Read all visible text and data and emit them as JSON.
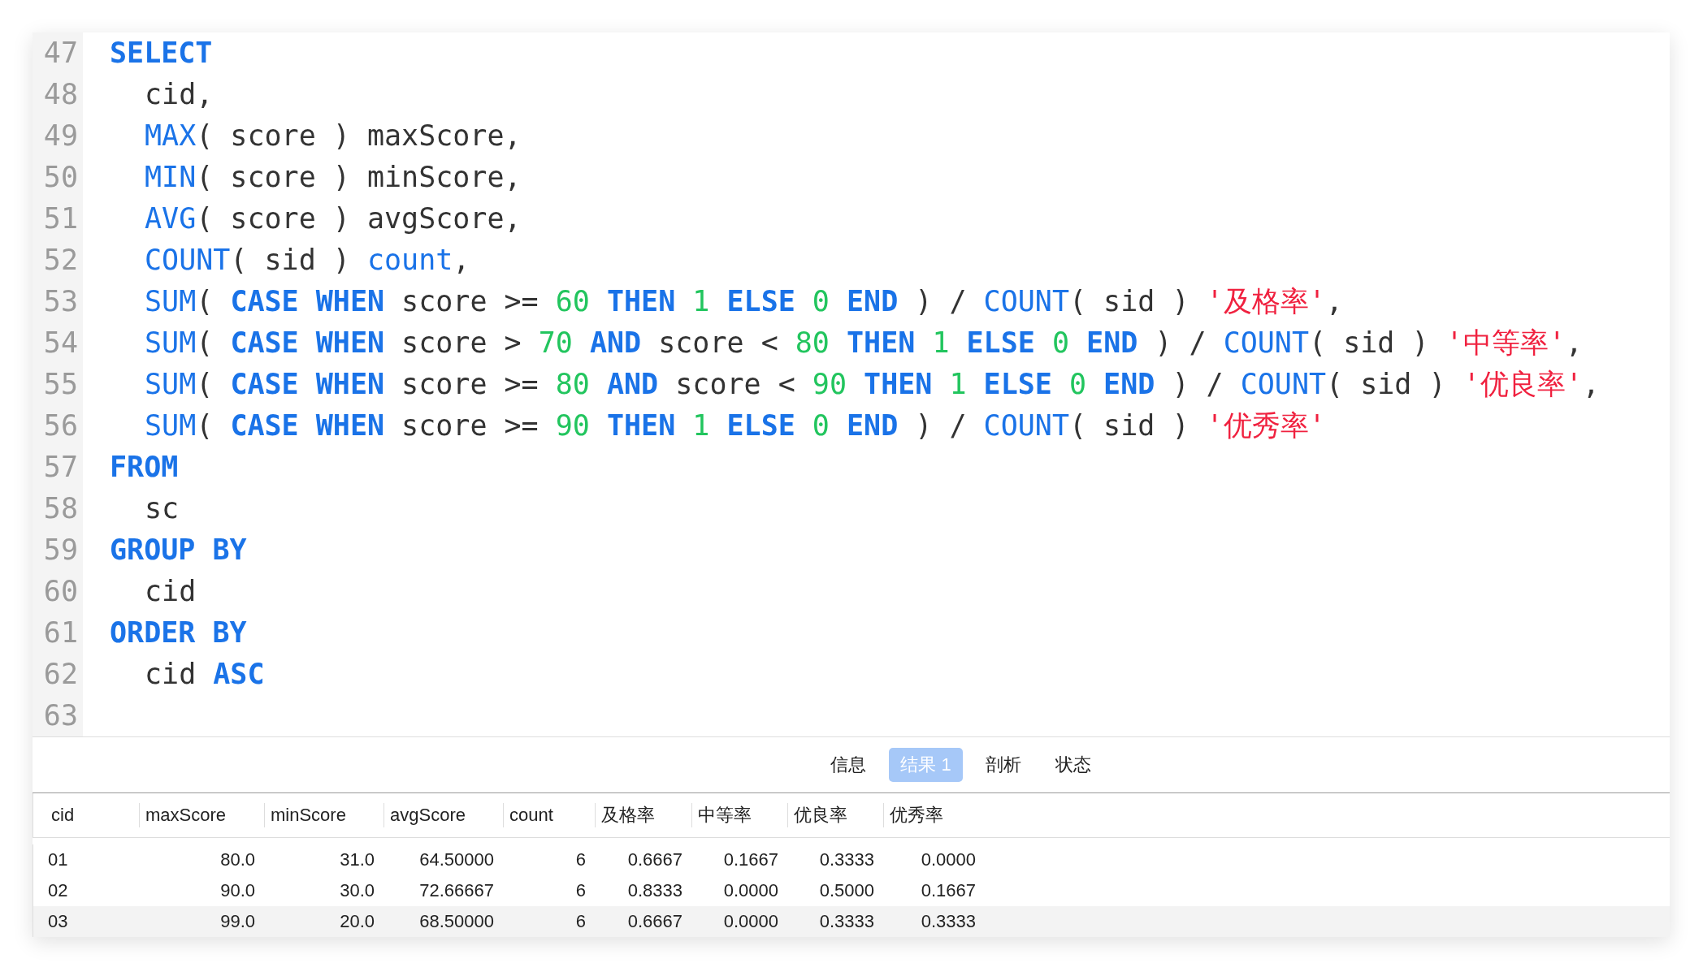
{
  "editor": {
    "lines": [
      {
        "number": "47",
        "indented": false,
        "tokens": [
          {
            "kind": "keyword",
            "text": "SELECT"
          }
        ]
      },
      {
        "number": "48",
        "indented": true,
        "tokens": [
          {
            "kind": "plain",
            "text": "cid,"
          }
        ]
      },
      {
        "number": "49",
        "indented": true,
        "tokens": [
          {
            "kind": "function",
            "text": "MAX"
          },
          {
            "kind": "plain",
            "text": "( score ) maxScore,"
          }
        ]
      },
      {
        "number": "50",
        "indented": true,
        "tokens": [
          {
            "kind": "function",
            "text": "MIN"
          },
          {
            "kind": "plain",
            "text": "( score ) minScore,"
          }
        ]
      },
      {
        "number": "51",
        "indented": true,
        "tokens": [
          {
            "kind": "function",
            "text": "AVG"
          },
          {
            "kind": "plain",
            "text": "( score ) avgScore,"
          }
        ]
      },
      {
        "number": "52",
        "indented": true,
        "tokens": [
          {
            "kind": "function",
            "text": "COUNT"
          },
          {
            "kind": "plain",
            "text": "( sid ) "
          },
          {
            "kind": "function",
            "text": "count"
          },
          {
            "kind": "plain",
            "text": ","
          }
        ]
      },
      {
        "number": "53",
        "indented": true,
        "tokens": [
          {
            "kind": "function",
            "text": "SUM"
          },
          {
            "kind": "plain",
            "text": "( "
          },
          {
            "kind": "keyword",
            "text": "CASE WHEN"
          },
          {
            "kind": "plain",
            "text": " score >= "
          },
          {
            "kind": "number",
            "text": "60"
          },
          {
            "kind": "keyword",
            "text": " THEN"
          },
          {
            "kind": "number",
            "text": " 1"
          },
          {
            "kind": "keyword",
            "text": " ELSE"
          },
          {
            "kind": "number",
            "text": " 0"
          },
          {
            "kind": "keyword",
            "text": " END"
          },
          {
            "kind": "plain",
            "text": " ) / "
          },
          {
            "kind": "function",
            "text": "COUNT"
          },
          {
            "kind": "plain",
            "text": "( sid ) "
          },
          {
            "kind": "string",
            "text": "'及格率'"
          },
          {
            "kind": "plain",
            "text": ","
          }
        ]
      },
      {
        "number": "54",
        "indented": true,
        "tokens": [
          {
            "kind": "function",
            "text": "SUM"
          },
          {
            "kind": "plain",
            "text": "( "
          },
          {
            "kind": "keyword",
            "text": "CASE WHEN"
          },
          {
            "kind": "plain",
            "text": " score > "
          },
          {
            "kind": "number",
            "text": "70"
          },
          {
            "kind": "keyword",
            "text": " AND"
          },
          {
            "kind": "plain",
            "text": " score < "
          },
          {
            "kind": "number",
            "text": "80"
          },
          {
            "kind": "keyword",
            "text": " THEN"
          },
          {
            "kind": "number",
            "text": " 1"
          },
          {
            "kind": "keyword",
            "text": " ELSE"
          },
          {
            "kind": "number",
            "text": " 0"
          },
          {
            "kind": "keyword",
            "text": " END"
          },
          {
            "kind": "plain",
            "text": " ) / "
          },
          {
            "kind": "function",
            "text": "COUNT"
          },
          {
            "kind": "plain",
            "text": "( sid ) "
          },
          {
            "kind": "string",
            "text": "'中等率'"
          },
          {
            "kind": "plain",
            "text": ","
          }
        ]
      },
      {
        "number": "55",
        "indented": true,
        "tokens": [
          {
            "kind": "function",
            "text": "SUM"
          },
          {
            "kind": "plain",
            "text": "( "
          },
          {
            "kind": "keyword",
            "text": "CASE WHEN"
          },
          {
            "kind": "plain",
            "text": " score >= "
          },
          {
            "kind": "number",
            "text": "80"
          },
          {
            "kind": "keyword",
            "text": " AND"
          },
          {
            "kind": "plain",
            "text": " score < "
          },
          {
            "kind": "number",
            "text": "90"
          },
          {
            "kind": "keyword",
            "text": " THEN"
          },
          {
            "kind": "number",
            "text": " 1"
          },
          {
            "kind": "keyword",
            "text": " ELSE"
          },
          {
            "kind": "number",
            "text": " 0"
          },
          {
            "kind": "keyword",
            "text": " END"
          },
          {
            "kind": "plain",
            "text": " ) / "
          },
          {
            "kind": "function",
            "text": "COUNT"
          },
          {
            "kind": "plain",
            "text": "( sid ) "
          },
          {
            "kind": "string",
            "text": "'优良率'"
          },
          {
            "kind": "plain",
            "text": ","
          }
        ]
      },
      {
        "number": "56",
        "indented": true,
        "tokens": [
          {
            "kind": "function",
            "text": "SUM"
          },
          {
            "kind": "plain",
            "text": "( "
          },
          {
            "kind": "keyword",
            "text": "CASE WHEN"
          },
          {
            "kind": "plain",
            "text": " score >= "
          },
          {
            "kind": "number",
            "text": "90"
          },
          {
            "kind": "keyword",
            "text": " THEN"
          },
          {
            "kind": "number",
            "text": " 1"
          },
          {
            "kind": "keyword",
            "text": " ELSE"
          },
          {
            "kind": "number",
            "text": " 0"
          },
          {
            "kind": "keyword",
            "text": " END"
          },
          {
            "kind": "plain",
            "text": " ) / "
          },
          {
            "kind": "function",
            "text": "COUNT"
          },
          {
            "kind": "plain",
            "text": "( sid ) "
          },
          {
            "kind": "string",
            "text": "'优秀率'"
          }
        ]
      },
      {
        "number": "57",
        "indented": false,
        "tokens": [
          {
            "kind": "keyword",
            "text": "FROM"
          }
        ]
      },
      {
        "number": "58",
        "indented": true,
        "tokens": [
          {
            "kind": "plain",
            "text": "sc"
          }
        ]
      },
      {
        "number": "59",
        "indented": false,
        "tokens": [
          {
            "kind": "keyword",
            "text": "GROUP BY"
          }
        ]
      },
      {
        "number": "60",
        "indented": true,
        "tokens": [
          {
            "kind": "plain",
            "text": "cid"
          }
        ]
      },
      {
        "number": "61",
        "indented": false,
        "tokens": [
          {
            "kind": "keyword",
            "text": "ORDER BY"
          }
        ]
      },
      {
        "number": "62",
        "indented": true,
        "tokens": [
          {
            "kind": "plain",
            "text": "cid "
          },
          {
            "kind": "keyword",
            "text": "ASC"
          }
        ]
      },
      {
        "number": "63"
      }
    ]
  },
  "result_tabs": [
    {
      "label": "信息",
      "selected": false
    },
    {
      "label": "结果 1",
      "selected": true
    },
    {
      "label": "剖析",
      "selected": false
    },
    {
      "label": "状态",
      "selected": false
    }
  ],
  "table": {
    "columns": [
      "cid",
      "maxScore",
      "minScore",
      "avgScore",
      "count",
      "及格率",
      "中等率",
      "优良率",
      "优秀率"
    ],
    "rows": [
      {
        "selected": false,
        "cells": [
          "01",
          "80.0",
          "31.0",
          "64.50000",
          "6",
          "0.6667",
          "0.1667",
          "0.3333",
          "0.0000"
        ]
      },
      {
        "selected": false,
        "cells": [
          "02",
          "90.0",
          "30.0",
          "72.66667",
          "6",
          "0.8333",
          "0.0000",
          "0.5000",
          "0.1667"
        ]
      },
      {
        "selected": true,
        "cells": [
          "03",
          "99.0",
          "20.0",
          "68.50000",
          "6",
          "0.6667",
          "0.0000",
          "0.3333",
          "0.3333"
        ]
      }
    ]
  }
}
